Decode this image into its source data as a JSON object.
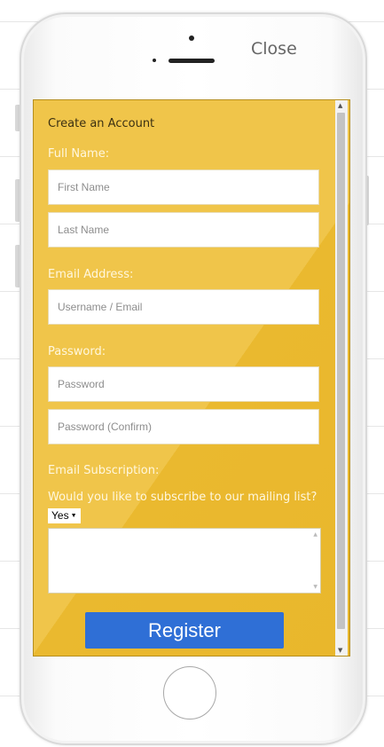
{
  "header": {
    "close_label": "Close"
  },
  "form": {
    "title": "Create an Account",
    "full_name_label": "Full Name:",
    "first_name_placeholder": "First Name",
    "last_name_placeholder": "Last Name",
    "email_label": "Email Address:",
    "email_placeholder": "Username / Email",
    "password_label": "Password:",
    "password_placeholder": "Password",
    "password_confirm_placeholder": "Password (Confirm)",
    "subscription_label": "Email Subscription:",
    "subscription_question": "Would you like to subscribe to our mailing list?",
    "subscription_value": "Yes",
    "register_label": "Register"
  },
  "colors": {
    "panel": "#f0c54a",
    "button": "#2f6fd6"
  }
}
